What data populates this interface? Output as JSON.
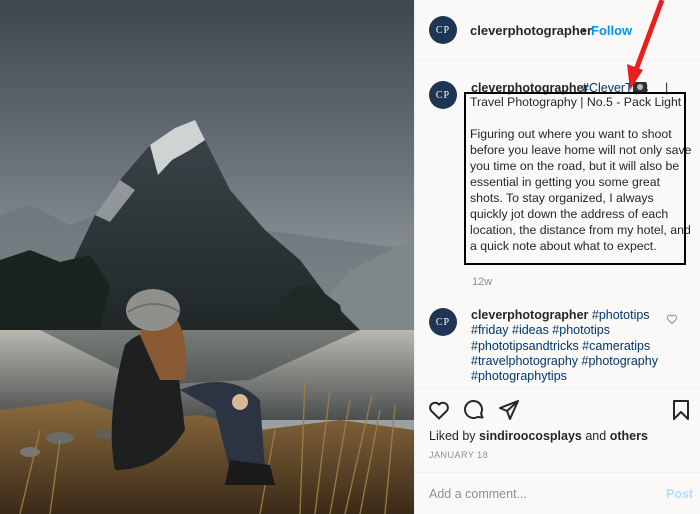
{
  "photo": {
    "alt": "Woman in a knit hat sitting by a lake facing misty mountains",
    "sky_color": "#5d6770",
    "water_color": "#9aa2a6"
  },
  "header": {
    "avatar_text": "CP",
    "username": "cleverphotographer",
    "separator": "•",
    "follow_label": "Follow"
  },
  "caption": {
    "avatar_text": "CP",
    "username": "cleverphotographer",
    "hashtag": "#CleverTips",
    "bar": "|",
    "text": "Travel Photography | No.5 - Pack Light\n\nFiguring out where you want to shoot before you leave home will not only save you time on the road, but it will also be essential in getting you some great shots. To stay organized, I always quickly jot down the address of each location, the distance from my hotel, and a quick note about what to expect.",
    "time": "12w"
  },
  "comment": {
    "avatar_text": "CP",
    "username": "cleverphotographer",
    "tags": "#phototips #friday #ideas #phototips #phototipsandtricks #cameratips #travelphotography #photography #photographytips"
  },
  "actions": {
    "liked_by_prefix": "Liked by",
    "liked_by_user": "sindiroocosplays",
    "liked_by_and": "and",
    "liked_by_others": "others",
    "date": "JANUARY 18"
  },
  "composer": {
    "placeholder": "Add a comment...",
    "post_label": "Post"
  },
  "colors": {
    "link": "#00376b",
    "follow": "#0095f6",
    "annotation_arrow": "#e8201d",
    "avatar_bg": "#1e3653"
  },
  "icons": [
    "heart-icon",
    "comment-icon",
    "share-icon",
    "bookmark-icon",
    "like-comment-icon"
  ]
}
